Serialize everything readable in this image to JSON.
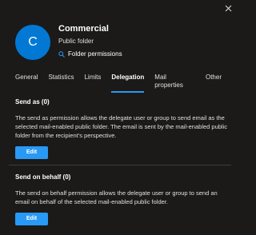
{
  "header": {
    "avatar_letter": "C",
    "title": "Commercial",
    "subtitle": "Public folder",
    "permissions_link": "Folder permissions"
  },
  "tabs": [
    {
      "label": "General"
    },
    {
      "label": "Statistics"
    },
    {
      "label": "Limits"
    },
    {
      "label": "Delegation",
      "active": true
    },
    {
      "label": "Mail properties"
    },
    {
      "label": "Other"
    }
  ],
  "send_as": {
    "title": "Send as (0)",
    "description": "The send as permission allows the delegate user or group to send email as the selected mail-enabled public folder. The email is sent by the mail-enabled public folder from the recipient's perspective.",
    "button": "Edit"
  },
  "send_on_behalf": {
    "title": "Send on behalf (0)",
    "description": "The send on behalf permission allows the delegate user or group to send an email on behalf of the selected mail-enabled public folder.",
    "button": "Edit"
  },
  "colors": {
    "background": "#1b1a19",
    "accent": "#2899f5",
    "avatar": "#0078d4"
  }
}
